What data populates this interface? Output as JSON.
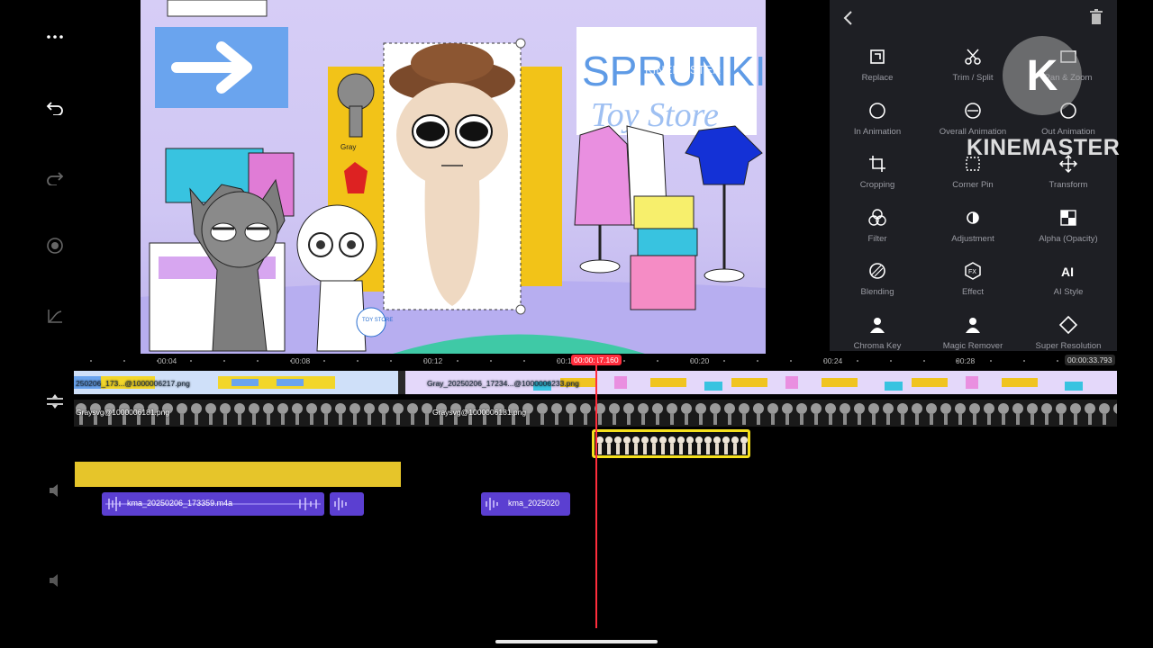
{
  "toolbar": {
    "more_icon": "more-dots-icon",
    "undo_icon": "undo-icon",
    "redo_icon": "redo-icon",
    "capture_icon": "capture-icon",
    "curve_icon": "keyframe-curve-icon"
  },
  "preview": {
    "sign_text_line1": "SPRUNKI",
    "sign_text_line2": "Toy Store",
    "watermark": "KINEMASTER",
    "tag_text": "TOY STORE",
    "small_label": "Gray"
  },
  "panel": {
    "back_icon": "back-chevron-icon",
    "delete_icon": "trash-icon",
    "watermark_letter": "K",
    "watermark_text": "KINEMASTER",
    "items": [
      {
        "label": "Replace",
        "icon": "replace-icon"
      },
      {
        "label": "Trim / Split",
        "icon": "scissors-icon"
      },
      {
        "label": "Pan & Zoom",
        "icon": "pan-zoom-icon"
      },
      {
        "label": "In Animation",
        "icon": "in-animation-icon"
      },
      {
        "label": "Overall Animation",
        "icon": "overall-animation-icon"
      },
      {
        "label": "Out Animation",
        "icon": "out-animation-icon"
      },
      {
        "label": "Cropping",
        "icon": "crop-icon"
      },
      {
        "label": "Corner Pin",
        "icon": "corner-pin-icon"
      },
      {
        "label": "Transform",
        "icon": "transform-icon"
      },
      {
        "label": "Filter",
        "icon": "filter-icon"
      },
      {
        "label": "Adjustment",
        "icon": "adjustment-icon"
      },
      {
        "label": "Alpha (Opacity)",
        "icon": "alpha-icon"
      },
      {
        "label": "Blending",
        "icon": "blending-icon"
      },
      {
        "label": "Effect",
        "icon": "effect-icon"
      },
      {
        "label": "AI Style",
        "icon": "ai-style-icon"
      },
      {
        "label": "Chroma Key",
        "icon": "chroma-key-icon"
      },
      {
        "label": "Magic Remover",
        "icon": "magic-remover-icon"
      },
      {
        "label": "Super Resolution",
        "icon": "super-resolution-icon"
      }
    ]
  },
  "timeline": {
    "ticks": [
      "00:04",
      "00:08",
      "00:12",
      "00:16",
      "00:20",
      "00:24",
      "00:28"
    ],
    "current_time": "00:00:17.160",
    "total_time": "00:00:33.793",
    "main_clip_1": "250206_173...@1000006217.png",
    "main_clip_2": "Gray_20250206_17234...@1000006233.png",
    "image_clip_1": "Graysvg@1000006181.png",
    "image_clip_2": "Graysvg@1000006181.png",
    "audio_clip_1": "kma_20250206_173359.m4a",
    "audio_clip_2": "kma_2025020"
  },
  "colors": {
    "accent": "#ff2d3c",
    "selection": "#f5e01c",
    "audio": "#5b3fd1",
    "text_layer": "#e6c52a",
    "panel_bg": "#1e1f24"
  }
}
